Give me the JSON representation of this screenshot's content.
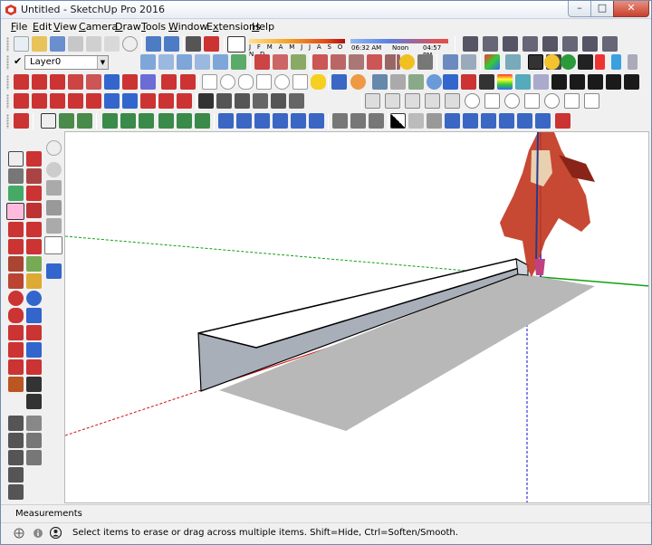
{
  "window": {
    "title": "Untitled - SketchUp Pro 2016",
    "min_glyph": "–",
    "max_glyph": "□",
    "close_glyph": "✕"
  },
  "menu": {
    "items": [
      {
        "label": "File",
        "key": "F",
        "rest": "ile"
      },
      {
        "label": "Edit",
        "key": "E",
        "rest": "dit"
      },
      {
        "label": "View",
        "key": "V",
        "rest": "iew"
      },
      {
        "label": "Camera",
        "key": "C",
        "rest": "amera"
      },
      {
        "label": "Draw",
        "key": "D",
        "rest": "raw"
      },
      {
        "label": "Tools",
        "key": "T",
        "rest": "ools"
      },
      {
        "label": "Window",
        "key": "W",
        "rest": "indow"
      },
      {
        "label": "Extensions",
        "key": "x",
        "pre": "E",
        "rest": "tensions"
      },
      {
        "label": "Help",
        "key": "H",
        "rest": "elp"
      }
    ]
  },
  "layers": {
    "current": "Layer0",
    "check_glyph": "✔",
    "arrow_glyph": "▼"
  },
  "shadows": {
    "months": "J F M A M J J A S O N D",
    "time_start": "06:32 AM",
    "time_noon": "Noon",
    "time_end": "04:57 PM"
  },
  "measurements": {
    "label": "Measurements",
    "value": ""
  },
  "status": {
    "text": "Select items to erase or drag across multiple items. Shift=Hide, Ctrl=Soften/Smooth."
  },
  "colors": {
    "x_axis": "#d01010",
    "y_axis": "#10a010",
    "z_axis": "#1010d0",
    "face_front": "#ffffff",
    "face_side": "#a5adb8",
    "shadow": "#b8b8b8",
    "accent_blue": "#3a66c4"
  },
  "icons": {
    "app": "sketchup-logo-icon",
    "geo": "geolocation-icon",
    "info": "info-icon",
    "user": "user-icon"
  }
}
